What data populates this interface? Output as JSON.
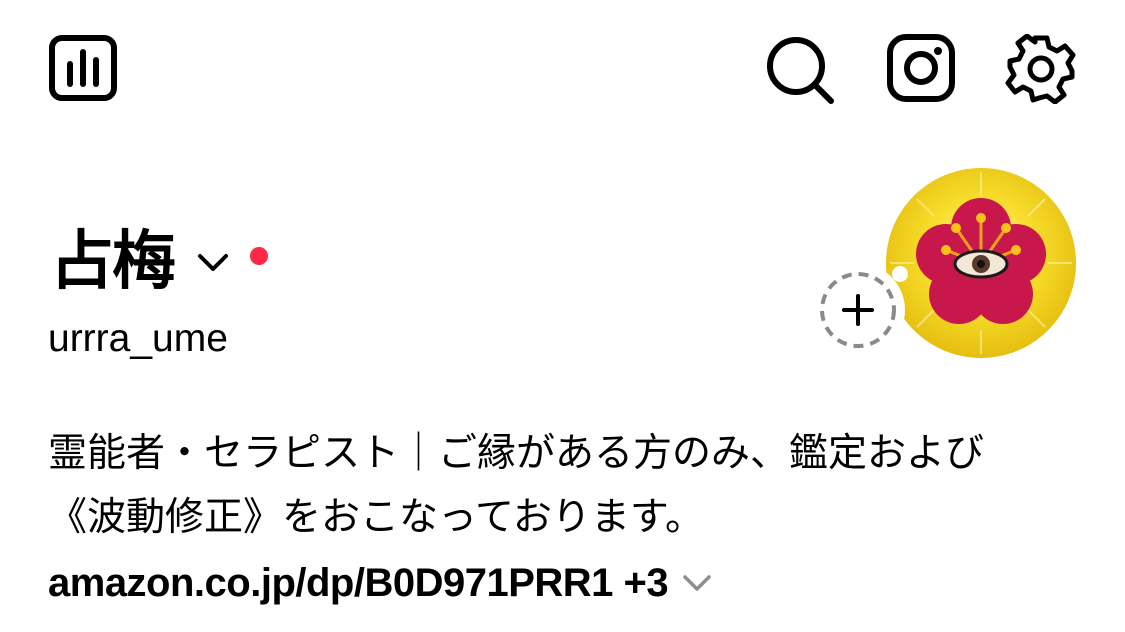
{
  "profile": {
    "display_name": "占梅",
    "username": "urrra_ume",
    "bio_lines": [
      "霊能者・セラピスト｜ご縁がある方のみ、鑑定および",
      "《波動修正》をおこなっております。"
    ],
    "link_text": "amazon.co.jp/dp/B0D971PRR1 +3",
    "has_notification_dot": true,
    "notification_dot_color": "#ff2848"
  },
  "toolbar": {
    "icons": [
      "insights-icon",
      "search-icon",
      "instagram-icon",
      "settings-gear-icon"
    ]
  },
  "colors": {
    "avatar_background": "#f2d21a",
    "avatar_flower": "#c8174a"
  }
}
